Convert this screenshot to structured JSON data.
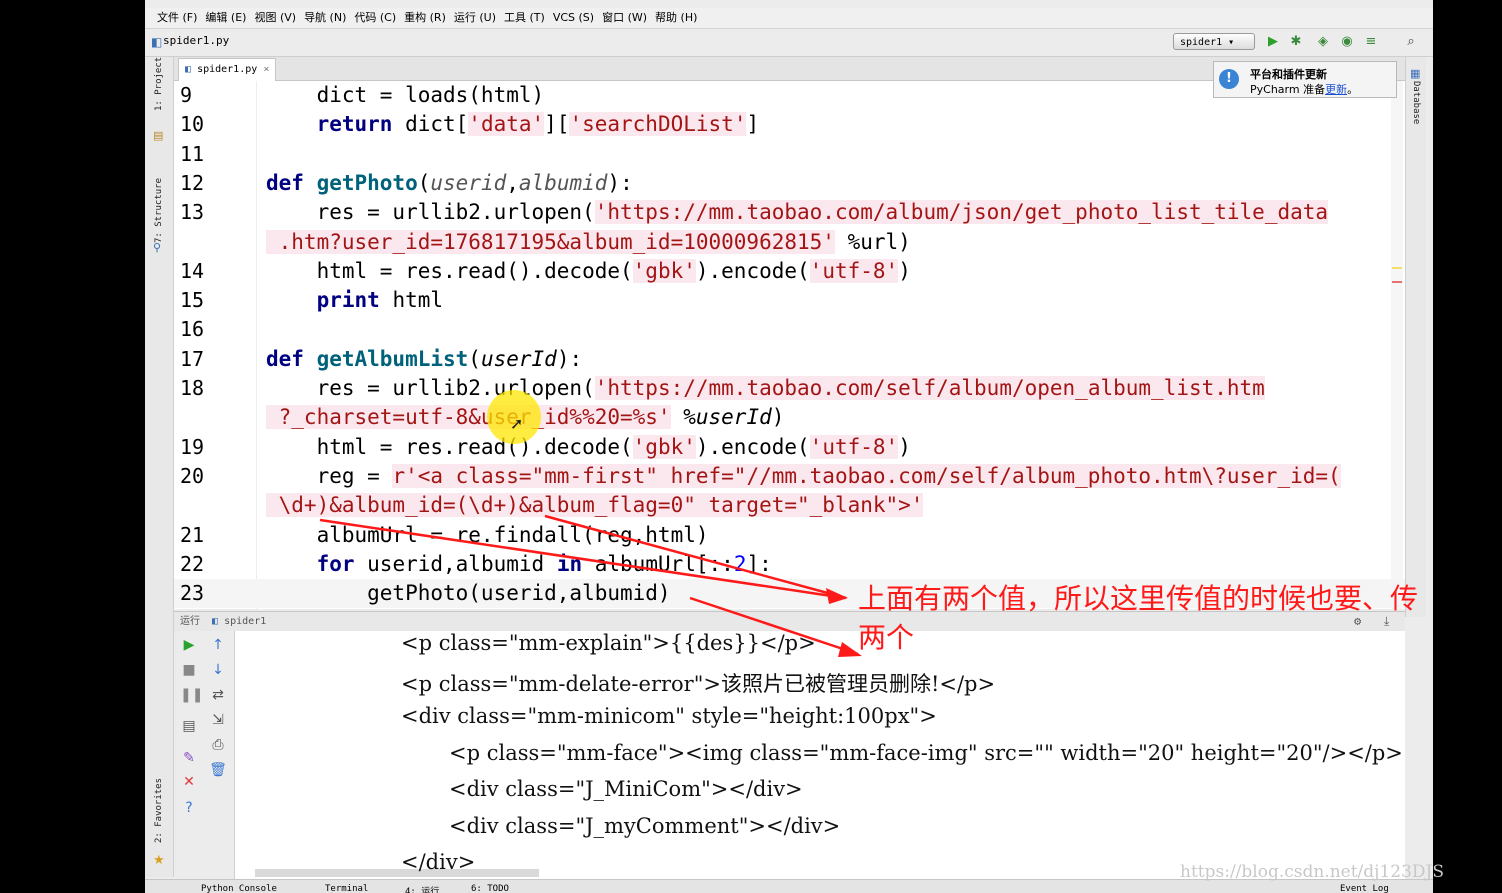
{
  "menu": [
    "文件 (F)",
    "编辑 (E)",
    "视图 (V)",
    "导航 (N)",
    "代码 (C)",
    "重构 (R)",
    "运行 (U)",
    "工具 (T)",
    "VCS (S)",
    "窗口 (W)",
    "帮助 (H)"
  ],
  "breadcrumb": "spider1.py",
  "run_config": "spider1",
  "editor_tab": "spider1.py",
  "left_tool_windows": [
    "1: Project",
    "7: Structure",
    "2: Favorites"
  ],
  "right_tool_windows": [
    "Database"
  ],
  "notification": {
    "title": "平台和插件更新",
    "body_prefix": "PyCharm 准备",
    "link": "更新",
    "suffix": "。"
  },
  "code": [
    {
      "n": "9",
      "parts": [
        [
          "",
          "    dict = loads(html)"
        ]
      ]
    },
    {
      "n": "10",
      "parts": [
        [
          "kw",
          "    return"
        ],
        [
          "",
          " dict["
        ],
        [
          "st",
          "'data'"
        ],
        [
          "",
          "]["
        ],
        [
          "st",
          "'searchDOList'"
        ],
        [
          "",
          "]"
        ]
      ]
    },
    {
      "n": "11",
      "parts": []
    },
    {
      "n": "12",
      "parts": [
        [
          "kw",
          "def "
        ],
        [
          "fn",
          "getPhoto"
        ],
        [
          "",
          "("
        ],
        [
          "it",
          "userid"
        ],
        [
          "",
          ","
        ],
        [
          "it",
          "albumid"
        ],
        [
          "",
          "):"
        ]
      ]
    },
    {
      "n": "13",
      "parts": [
        [
          "",
          "    res = urllib2.urlopen("
        ],
        [
          "st",
          "'https://mm.taobao.com/album/json/get_photo_list_tile_data"
        ]
      ]
    },
    {
      "n": "",
      "parts": [
        [
          "st",
          " .htm?user_id=176817195&album_id=10000962815'"
        ],
        [
          "",
          " %url)"
        ]
      ]
    },
    {
      "n": "14",
      "parts": [
        [
          "",
          "    html = res.read().decode("
        ],
        [
          "st",
          "'gbk'"
        ],
        [
          "",
          ").encode("
        ],
        [
          "st",
          "'utf-8'"
        ],
        [
          "",
          ")"
        ]
      ]
    },
    {
      "n": "15",
      "parts": [
        [
          "kw",
          "    print"
        ],
        [
          "",
          " html"
        ]
      ]
    },
    {
      "n": "16",
      "parts": []
    },
    {
      "n": "17",
      "parts": [
        [
          "kw",
          "def "
        ],
        [
          "fn",
          "getAlbumList"
        ],
        [
          "",
          "("
        ],
        [
          "ps",
          "userId"
        ],
        [
          "",
          "):"
        ]
      ]
    },
    {
      "n": "18",
      "parts": [
        [
          "",
          "    res = urllib2.urlopen("
        ],
        [
          "st",
          "'https://mm.taobao.com/self/album/open_album_list.htm"
        ]
      ]
    },
    {
      "n": "",
      "parts": [
        [
          "st",
          " ?_charset=utf-8&user_id%%20=%s'"
        ],
        [
          "",
          " %"
        ],
        [
          "ps",
          "userId"
        ],
        [
          "",
          ")"
        ]
      ]
    },
    {
      "n": "19",
      "parts": [
        [
          "",
          "    html = res.read().decode("
        ],
        [
          "st",
          "'gbk'"
        ],
        [
          "",
          ").encode("
        ],
        [
          "st",
          "'utf-8'"
        ],
        [
          "",
          ")"
        ]
      ]
    },
    {
      "n": "20",
      "parts": [
        [
          "",
          "    reg = "
        ],
        [
          "st",
          "r'<a class=\"mm-first\" href=\"//mm.taobao.com/self/album_photo.htm\\?user_id=("
        ]
      ]
    },
    {
      "n": "",
      "parts": [
        [
          "st",
          " \\d+)&album_id=(\\d+)&album_flag=0\" target=\"_blank\">'"
        ]
      ]
    },
    {
      "n": "21",
      "parts": [
        [
          "",
          "    albumUrl = re.findall(reg,html)"
        ]
      ]
    },
    {
      "n": "22",
      "parts": [
        [
          "kw",
          "    for"
        ],
        [
          "",
          " userid,albumid "
        ],
        [
          "kw",
          "in"
        ],
        [
          "",
          " albumUrl[::"
        ],
        [
          "nm",
          "2"
        ],
        [
          "",
          "]:"
        ]
      ]
    },
    {
      "n": "23",
      "parts": [
        [
          "",
          "        getPhoto(userid,albumid)"
        ]
      ]
    }
  ],
  "run_header": {
    "label": "运行",
    "config": "spider1"
  },
  "console_lines": [
    {
      "indent": 0,
      "text": "<p class=\"mm-explain\">{{des}}</p>"
    },
    {
      "indent": 0,
      "text": "<p class=\"mm-delate-error\">该照片已被管理员删除!</p>"
    },
    {
      "indent": 0,
      "text": "<div class=\"mm-minicom\" style=\"height:100px\">"
    },
    {
      "indent": 1,
      "text": "<p class=\"mm-face\"><img class=\"mm-face-img\" src=\"\" width=\"20\" height=\"20\"/></p>"
    },
    {
      "indent": 1,
      "text": "<div class=\"J_MiniCom\"></div>"
    },
    {
      "indent": 1,
      "text": "<div class=\"J_myComment\"></div>"
    },
    {
      "indent": 0,
      "text": "</div>"
    }
  ],
  "bottom_tabs": [
    "Python Console",
    "Terminal",
    "4: 运行",
    "6: TODO",
    "Event Log"
  ],
  "annotation": {
    "line1": "上面有两个值，所以这里传值的时候也要、传",
    "line2": "两个",
    "color": "#ff1a1a"
  },
  "watermark": "https://blog.csdn.net/dj123DJS"
}
